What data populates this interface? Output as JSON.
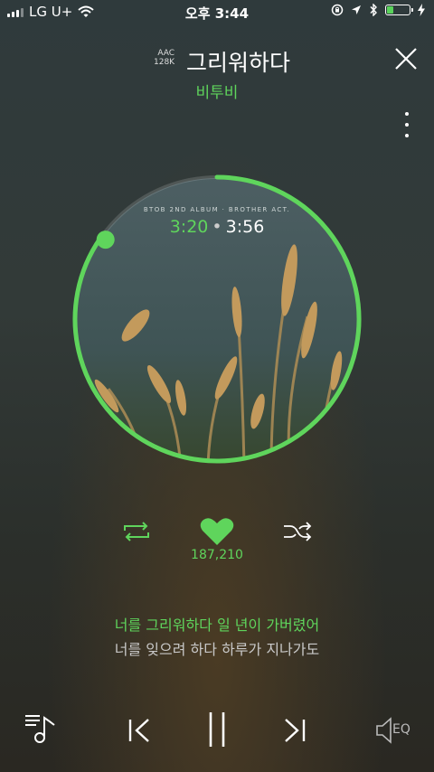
{
  "status_bar": {
    "carrier": "LG U+",
    "time": "오후 3:44",
    "battery_color": "#59d35b"
  },
  "header": {
    "quality_line1": "AAC",
    "quality_line2": "128K",
    "title": "그리워하다",
    "artist": "비투비"
  },
  "album": {
    "caption": "BTOB 2ND ALBUM · BROTHER ACT.",
    "current_time": "3:20",
    "separator": "•",
    "total_time": "3:56",
    "progress": 0.847
  },
  "actions": {
    "likes": "187,210"
  },
  "lyrics": {
    "current": "너를 그리워하다 일 년이 가버렸어",
    "next": "너를 잊으려 하다 하루가 지나가도"
  },
  "bottom_bar": {
    "eq_label": "EQ"
  },
  "colors": {
    "accent": "#5fd55c"
  },
  "icons": [
    "wifi-icon",
    "lock-rotation-icon",
    "location-icon",
    "bluetooth-icon",
    "charging-icon",
    "close-icon",
    "more-icon",
    "repeat-icon",
    "heart-icon",
    "shuffle-icon",
    "playlist-icon",
    "previous-icon",
    "pause-icon",
    "next-icon",
    "eq-icon"
  ]
}
